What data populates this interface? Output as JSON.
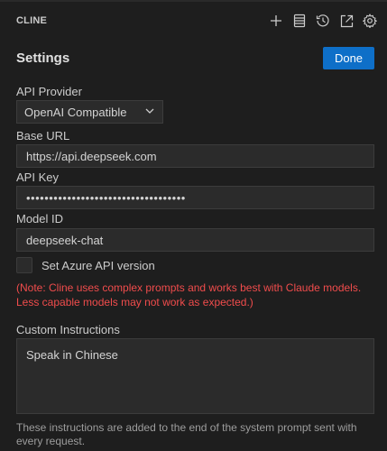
{
  "header": {
    "title": "CLINE",
    "icons": [
      "plus-icon",
      "history-list-icon",
      "history-clock-icon",
      "popout-icon",
      "gear-icon"
    ]
  },
  "settings": {
    "title": "Settings",
    "done_label": "Done"
  },
  "api_provider": {
    "label": "API Provider",
    "selected": "OpenAI Compatible"
  },
  "base_url": {
    "label": "Base URL",
    "value": "https://api.deepseek.com"
  },
  "api_key": {
    "label": "API Key",
    "value": "•••••••••••••••••••••••••••••••••••"
  },
  "model_id": {
    "label": "Model ID",
    "value": "deepseek-chat"
  },
  "azure": {
    "label": "Set Azure API version",
    "checked": false
  },
  "note": {
    "text": "(Note: Cline uses complex prompts and works best with Claude models. Less capable models may not work as expected.)"
  },
  "custom_instructions": {
    "label": "Custom Instructions",
    "value": "Speak in Chinese",
    "help": "These instructions are added to the end of the system prompt sent with every request."
  },
  "colors": {
    "background": "#1e1e1e",
    "accent": "#0e6fc8",
    "note": "#f14c4c"
  }
}
